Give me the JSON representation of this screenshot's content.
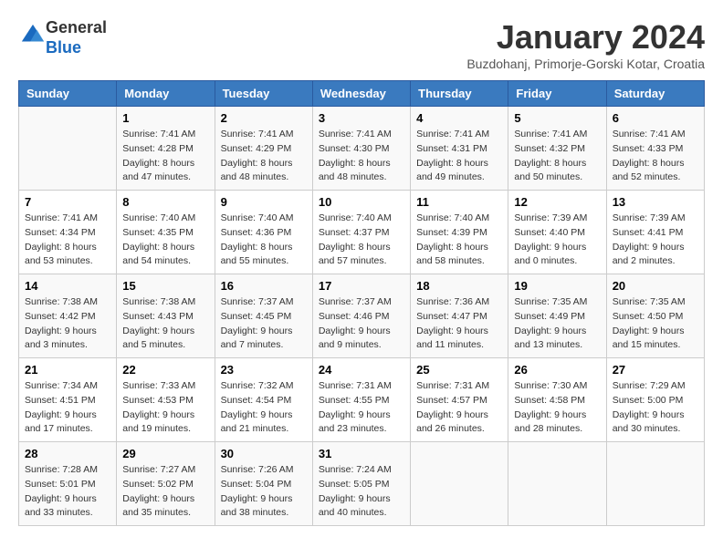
{
  "header": {
    "logo_line1": "General",
    "logo_line2": "Blue",
    "month": "January 2024",
    "location": "Buzdohanj, Primorje-Gorski Kotar, Croatia"
  },
  "weekdays": [
    "Sunday",
    "Monday",
    "Tuesday",
    "Wednesday",
    "Thursday",
    "Friday",
    "Saturday"
  ],
  "weeks": [
    [
      {
        "day": "",
        "sunrise": "",
        "sunset": "",
        "daylight": ""
      },
      {
        "day": "1",
        "sunrise": "Sunrise: 7:41 AM",
        "sunset": "Sunset: 4:28 PM",
        "daylight": "Daylight: 8 hours and 47 minutes."
      },
      {
        "day": "2",
        "sunrise": "Sunrise: 7:41 AM",
        "sunset": "Sunset: 4:29 PM",
        "daylight": "Daylight: 8 hours and 48 minutes."
      },
      {
        "day": "3",
        "sunrise": "Sunrise: 7:41 AM",
        "sunset": "Sunset: 4:30 PM",
        "daylight": "Daylight: 8 hours and 48 minutes."
      },
      {
        "day": "4",
        "sunrise": "Sunrise: 7:41 AM",
        "sunset": "Sunset: 4:31 PM",
        "daylight": "Daylight: 8 hours and 49 minutes."
      },
      {
        "day": "5",
        "sunrise": "Sunrise: 7:41 AM",
        "sunset": "Sunset: 4:32 PM",
        "daylight": "Daylight: 8 hours and 50 minutes."
      },
      {
        "day": "6",
        "sunrise": "Sunrise: 7:41 AM",
        "sunset": "Sunset: 4:33 PM",
        "daylight": "Daylight: 8 hours and 52 minutes."
      }
    ],
    [
      {
        "day": "7",
        "sunrise": "Sunrise: 7:41 AM",
        "sunset": "Sunset: 4:34 PM",
        "daylight": "Daylight: 8 hours and 53 minutes."
      },
      {
        "day": "8",
        "sunrise": "Sunrise: 7:40 AM",
        "sunset": "Sunset: 4:35 PM",
        "daylight": "Daylight: 8 hours and 54 minutes."
      },
      {
        "day": "9",
        "sunrise": "Sunrise: 7:40 AM",
        "sunset": "Sunset: 4:36 PM",
        "daylight": "Daylight: 8 hours and 55 minutes."
      },
      {
        "day": "10",
        "sunrise": "Sunrise: 7:40 AM",
        "sunset": "Sunset: 4:37 PM",
        "daylight": "Daylight: 8 hours and 57 minutes."
      },
      {
        "day": "11",
        "sunrise": "Sunrise: 7:40 AM",
        "sunset": "Sunset: 4:39 PM",
        "daylight": "Daylight: 8 hours and 58 minutes."
      },
      {
        "day": "12",
        "sunrise": "Sunrise: 7:39 AM",
        "sunset": "Sunset: 4:40 PM",
        "daylight": "Daylight: 9 hours and 0 minutes."
      },
      {
        "day": "13",
        "sunrise": "Sunrise: 7:39 AM",
        "sunset": "Sunset: 4:41 PM",
        "daylight": "Daylight: 9 hours and 2 minutes."
      }
    ],
    [
      {
        "day": "14",
        "sunrise": "Sunrise: 7:38 AM",
        "sunset": "Sunset: 4:42 PM",
        "daylight": "Daylight: 9 hours and 3 minutes."
      },
      {
        "day": "15",
        "sunrise": "Sunrise: 7:38 AM",
        "sunset": "Sunset: 4:43 PM",
        "daylight": "Daylight: 9 hours and 5 minutes."
      },
      {
        "day": "16",
        "sunrise": "Sunrise: 7:37 AM",
        "sunset": "Sunset: 4:45 PM",
        "daylight": "Daylight: 9 hours and 7 minutes."
      },
      {
        "day": "17",
        "sunrise": "Sunrise: 7:37 AM",
        "sunset": "Sunset: 4:46 PM",
        "daylight": "Daylight: 9 hours and 9 minutes."
      },
      {
        "day": "18",
        "sunrise": "Sunrise: 7:36 AM",
        "sunset": "Sunset: 4:47 PM",
        "daylight": "Daylight: 9 hours and 11 minutes."
      },
      {
        "day": "19",
        "sunrise": "Sunrise: 7:35 AM",
        "sunset": "Sunset: 4:49 PM",
        "daylight": "Daylight: 9 hours and 13 minutes."
      },
      {
        "day": "20",
        "sunrise": "Sunrise: 7:35 AM",
        "sunset": "Sunset: 4:50 PM",
        "daylight": "Daylight: 9 hours and 15 minutes."
      }
    ],
    [
      {
        "day": "21",
        "sunrise": "Sunrise: 7:34 AM",
        "sunset": "Sunset: 4:51 PM",
        "daylight": "Daylight: 9 hours and 17 minutes."
      },
      {
        "day": "22",
        "sunrise": "Sunrise: 7:33 AM",
        "sunset": "Sunset: 4:53 PM",
        "daylight": "Daylight: 9 hours and 19 minutes."
      },
      {
        "day": "23",
        "sunrise": "Sunrise: 7:32 AM",
        "sunset": "Sunset: 4:54 PM",
        "daylight": "Daylight: 9 hours and 21 minutes."
      },
      {
        "day": "24",
        "sunrise": "Sunrise: 7:31 AM",
        "sunset": "Sunset: 4:55 PM",
        "daylight": "Daylight: 9 hours and 23 minutes."
      },
      {
        "day": "25",
        "sunrise": "Sunrise: 7:31 AM",
        "sunset": "Sunset: 4:57 PM",
        "daylight": "Daylight: 9 hours and 26 minutes."
      },
      {
        "day": "26",
        "sunrise": "Sunrise: 7:30 AM",
        "sunset": "Sunset: 4:58 PM",
        "daylight": "Daylight: 9 hours and 28 minutes."
      },
      {
        "day": "27",
        "sunrise": "Sunrise: 7:29 AM",
        "sunset": "Sunset: 5:00 PM",
        "daylight": "Daylight: 9 hours and 30 minutes."
      }
    ],
    [
      {
        "day": "28",
        "sunrise": "Sunrise: 7:28 AM",
        "sunset": "Sunset: 5:01 PM",
        "daylight": "Daylight: 9 hours and 33 minutes."
      },
      {
        "day": "29",
        "sunrise": "Sunrise: 7:27 AM",
        "sunset": "Sunset: 5:02 PM",
        "daylight": "Daylight: 9 hours and 35 minutes."
      },
      {
        "day": "30",
        "sunrise": "Sunrise: 7:26 AM",
        "sunset": "Sunset: 5:04 PM",
        "daylight": "Daylight: 9 hours and 38 minutes."
      },
      {
        "day": "31",
        "sunrise": "Sunrise: 7:24 AM",
        "sunset": "Sunset: 5:05 PM",
        "daylight": "Daylight: 9 hours and 40 minutes."
      },
      {
        "day": "",
        "sunrise": "",
        "sunset": "",
        "daylight": ""
      },
      {
        "day": "",
        "sunrise": "",
        "sunset": "",
        "daylight": ""
      },
      {
        "day": "",
        "sunrise": "",
        "sunset": "",
        "daylight": ""
      }
    ]
  ]
}
